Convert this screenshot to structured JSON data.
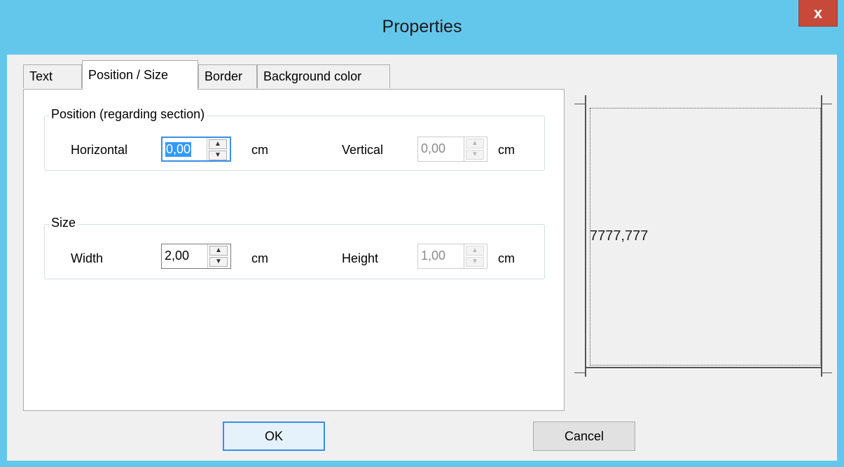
{
  "window": {
    "title": "Properties",
    "close_label": "x"
  },
  "tabs": [
    {
      "label": "Text",
      "active": false
    },
    {
      "label": "Position / Size",
      "active": true
    },
    {
      "label": "Border",
      "active": false
    },
    {
      "label": "Background color",
      "active": false
    }
  ],
  "position_group": {
    "legend": "Position (regarding section)",
    "horizontal": {
      "label": "Horizontal",
      "value": "0,00",
      "unit": "cm",
      "enabled": true,
      "focused": true
    },
    "vertical": {
      "label": "Vertical",
      "value": "0,00",
      "unit": "cm",
      "enabled": false
    }
  },
  "size_group": {
    "legend": "Size",
    "width": {
      "label": "Width",
      "value": "2,00",
      "unit": "cm",
      "enabled": true
    },
    "height": {
      "label": "Height",
      "value": "1,00",
      "unit": "cm",
      "enabled": false
    }
  },
  "preview": {
    "sample_text": "7777,777"
  },
  "buttons": {
    "ok": "OK",
    "cancel": "Cancel"
  },
  "icons": {
    "spin_up": "▲",
    "spin_down": "▼"
  },
  "colors": {
    "titlebar": "#63c7ec",
    "close": "#c7493a",
    "focus": "#3c8ee6"
  }
}
